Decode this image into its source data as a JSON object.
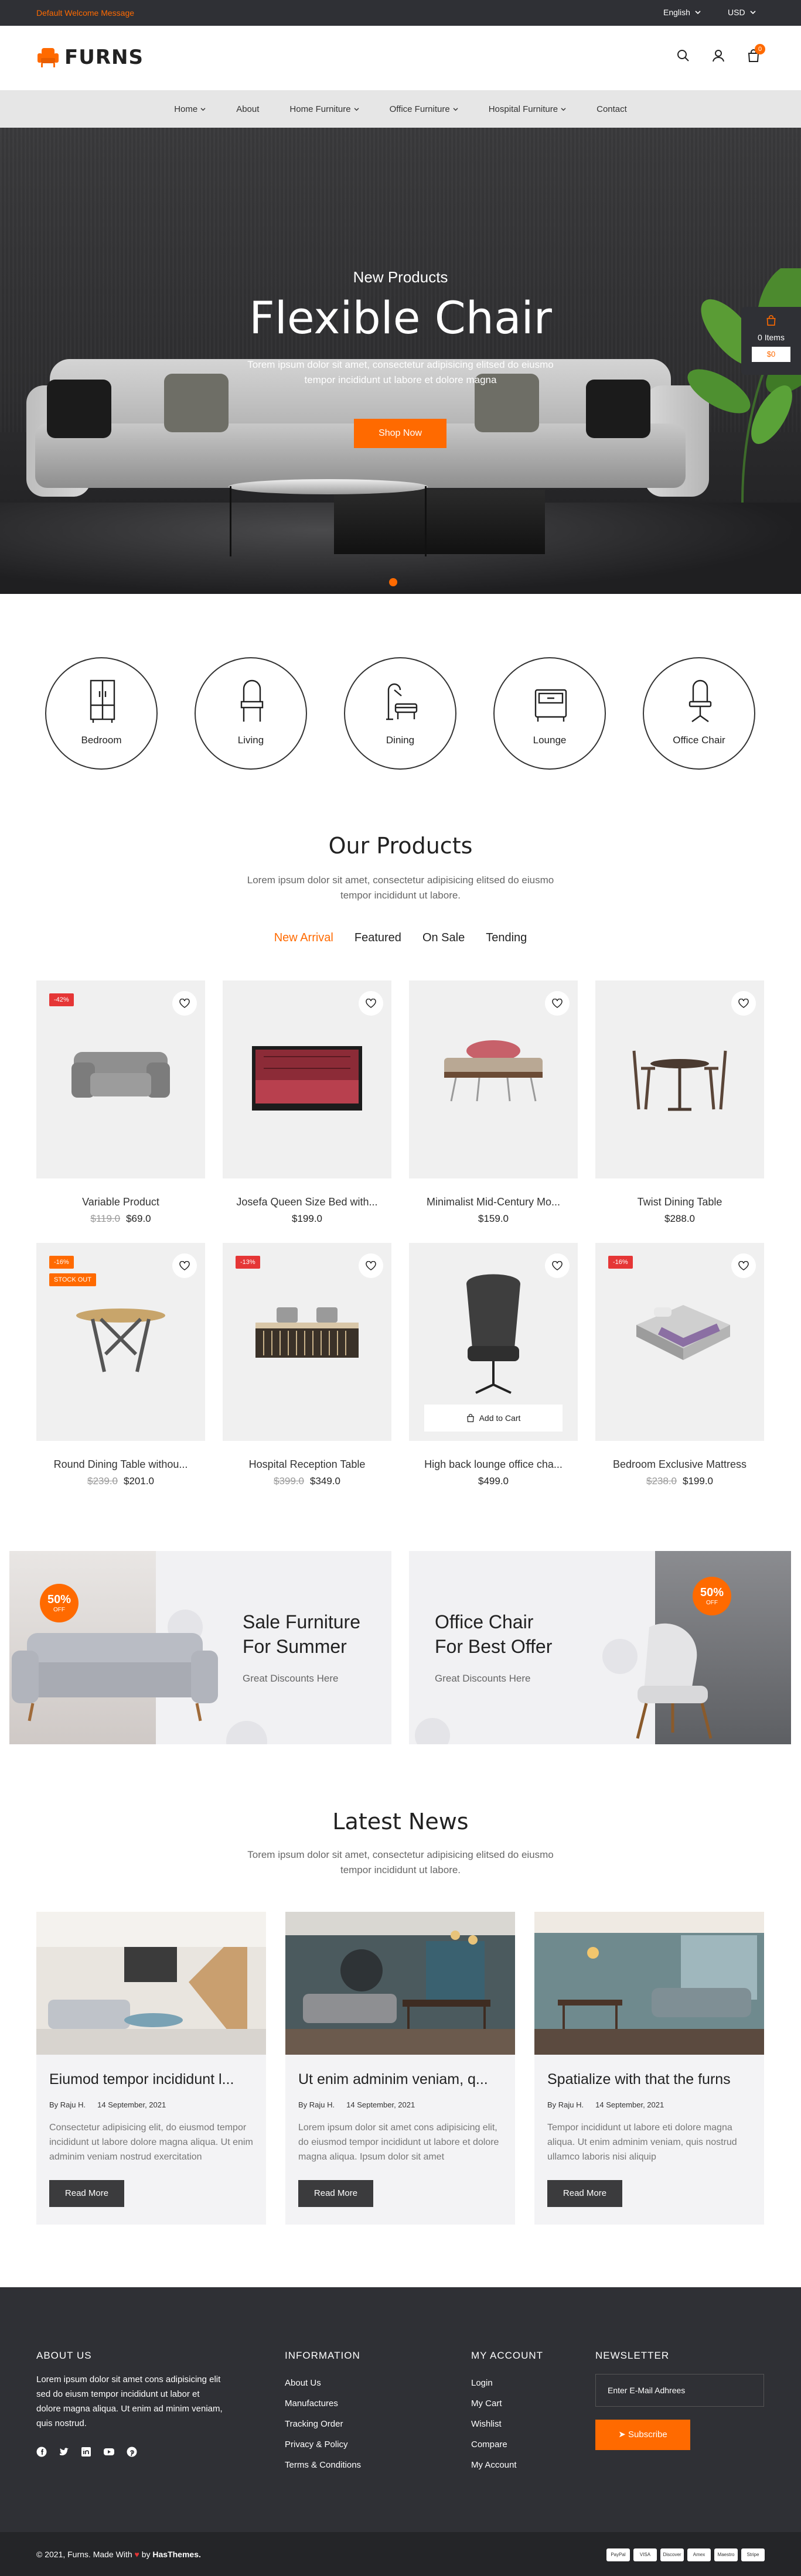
{
  "topbar": {
    "welcome": "Default Welcome Message",
    "language": "English",
    "currency": "USD"
  },
  "header": {
    "logo_text": "FURNS",
    "cart_count": "0"
  },
  "nav": {
    "items": [
      {
        "label": "Home",
        "dropdown": true
      },
      {
        "label": "About",
        "dropdown": false
      },
      {
        "label": "Home Furniture",
        "dropdown": true
      },
      {
        "label": "Office Furniture",
        "dropdown": true
      },
      {
        "label": "Hospital Furniture",
        "dropdown": true
      },
      {
        "label": "Contact",
        "dropdown": false
      }
    ]
  },
  "hero": {
    "subtitle": "New Products",
    "title": "Flexible Chair",
    "description": "Torem ipsum dolor sit amet, consectetur adipisicing elitsed do eiusmo tempor incididunt ut labore et dolore magna",
    "button": "Shop Now"
  },
  "mini_cart": {
    "items_label": "0 Items",
    "amount": "$0"
  },
  "categories": [
    {
      "label": "Bedroom",
      "icon": "wardrobe-icon"
    },
    {
      "label": "Living",
      "icon": "chair-icon"
    },
    {
      "label": "Dining",
      "icon": "dining-icon"
    },
    {
      "label": "Lounge",
      "icon": "nightstand-icon"
    },
    {
      "label": "Office Chair",
      "icon": "office-chair-icon"
    }
  ],
  "products_section": {
    "title": "Our Products",
    "description": "Lorem ipsum dolor sit amet, consectetur adipisicing elitsed do eiusmo tempor incididunt ut labore.",
    "tabs": [
      "New Arrival",
      "Featured",
      "On Sale",
      "Tending"
    ]
  },
  "products": [
    {
      "name": "Variable Product",
      "old_price": "$119.0",
      "price": "$69.0",
      "badge": "-42%",
      "stock": ""
    },
    {
      "name": "Josefa Queen Size Bed with...",
      "old_price": "",
      "price": "$199.0",
      "badge": "",
      "stock": ""
    },
    {
      "name": "Minimalist Mid-Century Mo...",
      "old_price": "",
      "price": "$159.0",
      "badge": "",
      "stock": ""
    },
    {
      "name": "Twist Dining Table",
      "old_price": "",
      "price": "$288.0",
      "badge": "",
      "stock": ""
    },
    {
      "name": "Round Dining Table withou...",
      "old_price": "$239.0",
      "price": "$201.0",
      "badge": "-16%",
      "stock": "STOCK OUT"
    },
    {
      "name": "Hospital Reception Table",
      "old_price": "$399.0",
      "price": "$349.0",
      "badge": "-13%",
      "stock": ""
    },
    {
      "name": "High back lounge office cha...",
      "old_price": "",
      "price": "$499.0",
      "badge": "",
      "stock": "",
      "add_to_cart": "Add to Cart"
    },
    {
      "name": "Bedroom Exclusive Mattress",
      "old_price": "$238.0",
      "price": "$199.0",
      "badge": "-16%",
      "stock": ""
    }
  ],
  "banners": [
    {
      "title_line1": "Sale Furniture",
      "title_line2": "For Summer",
      "subtitle": "Great Discounts Here",
      "badge_big": "50%",
      "badge_small": "OFF"
    },
    {
      "title_line1": "Office Chair",
      "title_line2": "For Best Offer",
      "subtitle": "Great Discounts Here",
      "badge_big": "50%",
      "badge_small": "OFF"
    }
  ],
  "news_section": {
    "title": "Latest News",
    "description": "Torem ipsum dolor sit amet, consectetur adipisicing elitsed do eiusmo tempor incididunt ut labore."
  },
  "news": [
    {
      "title": "Eiumod tempor incididunt l...",
      "author": "By  Raju H.",
      "date": "14 September, 2021",
      "desc": "Consectetur adipisicing elit, do eiusmod tempor incididunt ut labore dolore magna aliqua. Ut enim adminim veniam nostrud exercitation",
      "button": "Read More"
    },
    {
      "title": "Ut enim adminim veniam, q...",
      "author": "By  Raju H.",
      "date": "14 September, 2021",
      "desc": "Lorem ipsum dolor sit amet cons adipisicing elit, do eiusmod tempor incididunt ut labore et dolore magna aliqua. Ipsum dolor sit amet",
      "button": "Read More"
    },
    {
      "title": "Spatialize with that the furns",
      "author": "By  Raju H.",
      "date": "14 September, 2021",
      "desc": "Tempor incididunt ut labore eti dolore magna aliqua. Ut enim adminim veniam, quis nostrud ullamco laboris nisi aliquip",
      "button": "Read More"
    }
  ],
  "footer": {
    "about_heading": "ABOUT US",
    "about_text": "Lorem ipsum dolor sit amet cons adipisicing elit sed do eiusm tempor incididunt ut labor et dolore magna aliqua. Ut enim ad minim veniam, quis nostrud.",
    "info_heading": "INFORMATION",
    "info_links": [
      "About Us",
      "Manufactures",
      "Tracking Order",
      "Privacy & Policy",
      "Terms & Conditions"
    ],
    "account_heading": "MY ACCOUNT",
    "account_links": [
      "Login",
      "My Cart",
      "Wishlist",
      "Compare",
      "My Account"
    ],
    "newsletter_heading": "NEWSLETTER",
    "newsletter_placeholder": "Enter E-Mail Adhrees",
    "subscribe": "Subscribe",
    "social_icons": [
      "facebook-icon",
      "twitter-icon",
      "linkedin-icon",
      "youtube-icon",
      "pinterest-icon"
    ]
  },
  "bottombar": {
    "copyright_prefix": "© 2021, Furns. Made With",
    "copyright_suffix": "by",
    "company": "HasThemes.",
    "payments": [
      "PayPal",
      "VISA",
      "Discover",
      "Amex",
      "Maestro",
      "Stripe"
    ]
  },
  "colors": {
    "accent": "#ff6a00",
    "dark": "#2f3035",
    "sale_badge": "#e53636"
  }
}
